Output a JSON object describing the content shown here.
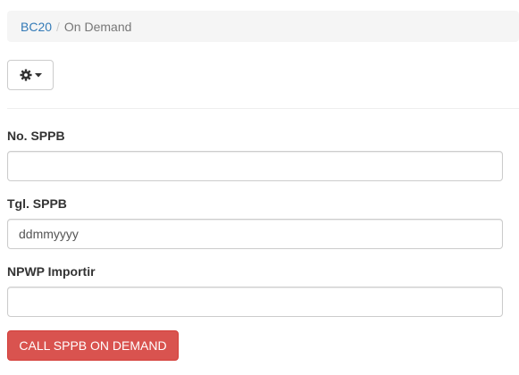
{
  "breadcrumb": {
    "items": [
      {
        "label": "BC20",
        "link": true
      },
      {
        "label": "On Demand",
        "link": false
      }
    ],
    "separator": "/"
  },
  "toolbar": {
    "tools_icon": "gear-icon",
    "dropdown_icon": "caret-down-icon"
  },
  "form": {
    "no_sppb": {
      "label": "No. SPPB",
      "value": "",
      "placeholder": ""
    },
    "tgl_sppb": {
      "label": "Tgl. SPPB",
      "value": "",
      "placeholder": "ddmmyyyy"
    },
    "npwp_importir": {
      "label": "NPWP Importir",
      "value": "",
      "placeholder": ""
    },
    "submit_label": "CALL SPPB ON DEMAND"
  },
  "colors": {
    "link": "#337ab7",
    "danger": "#d9534f",
    "breadcrumb_bg": "#f5f5f5"
  }
}
